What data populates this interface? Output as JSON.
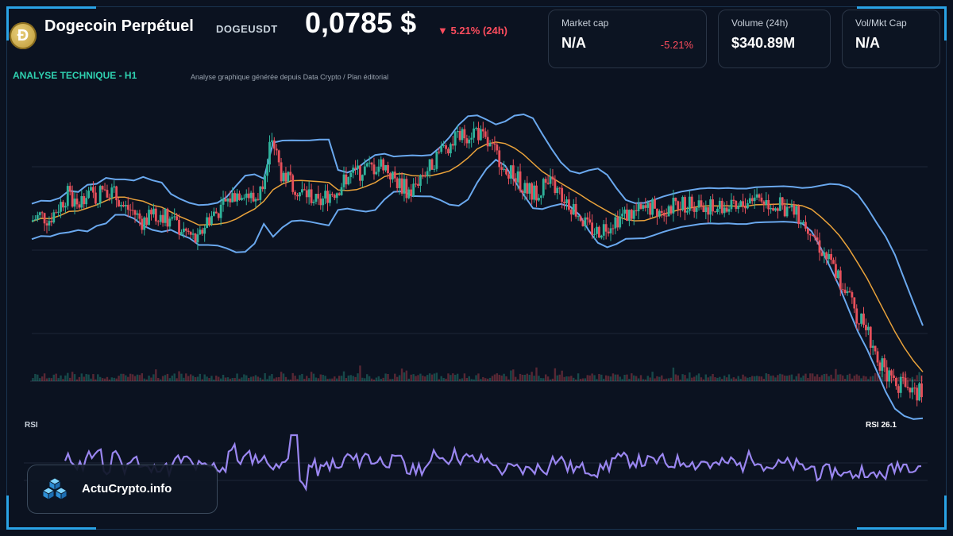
{
  "header": {
    "coin_icon": "dogecoin-icon",
    "coin_glyph": "Ð",
    "title": "Dogecoin Perpétuel",
    "ticker": "DOGEUSDT",
    "price": "0,0785 $",
    "change": "▼ 5.21% (24h)"
  },
  "cards": [
    {
      "label": "Market cap",
      "value": "N/A",
      "sub": "-5.21%"
    },
    {
      "label": "Volume (24h)",
      "value": "$340.89M",
      "sub": ""
    },
    {
      "label": "Vol/Mkt Cap",
      "value": "N/A",
      "sub": ""
    }
  ],
  "analysis": {
    "title": "ANALYSE TECHNIQUE - H1",
    "subtitle": "Analyse graphique générée depuis Data Crypto / Plan éditorial"
  },
  "rsi": {
    "label": "RSI",
    "value_label": "RSI 26.1"
  },
  "brand": {
    "name": "ActuCrypto.info",
    "icon": "cubes-icon"
  },
  "colors": {
    "up": "#2fb39b",
    "down": "#e8505b",
    "bollinger": "#6aa8ee",
    "ma": "#e9a23b",
    "rsi": "#9a86f0",
    "accent": "#2aa3e6",
    "ta_label": "#2fd1b0"
  },
  "chart_data": {
    "type": "line",
    "series": [
      {
        "values": [
          0.0912,
          0.0915,
          0.0913,
          0.0919,
          0.0925,
          0.0918,
          0.0927,
          0.0923,
          0.0929,
          0.0925,
          0.0919,
          0.0917,
          0.0912,
          0.0914,
          0.0916,
          0.0913,
          0.0909,
          0.0906,
          0.0902,
          0.0913,
          0.0916,
          0.0921,
          0.0925,
          0.0927,
          0.0922,
          0.0928,
          0.0952,
          0.0935,
          0.0932,
          0.0926,
          0.0925,
          0.092,
          0.0925,
          0.0927,
          0.0933,
          0.0935,
          0.0937,
          0.0938,
          0.094,
          0.0933,
          0.0929,
          0.0926,
          0.0934,
          0.0938,
          0.0945,
          0.0949,
          0.0952,
          0.0954,
          0.0956,
          0.095,
          0.0945,
          0.094,
          0.0934,
          0.093,
          0.0925,
          0.0928,
          0.093,
          0.0926,
          0.0921,
          0.0916,
          0.0909,
          0.0907,
          0.091,
          0.0913,
          0.0915,
          0.0916,
          0.0917,
          0.0919,
          0.0918,
          0.0919,
          0.0921,
          0.092,
          0.0921,
          0.0919,
          0.0918,
          0.0919,
          0.0917,
          0.0921,
          0.0925,
          0.0922,
          0.092,
          0.0919,
          0.0917,
          0.0913,
          0.0909,
          0.09,
          0.0893,
          0.0886,
          0.0876,
          0.0867,
          0.0861,
          0.0849,
          0.084,
          0.0834,
          0.0833,
          0.0831,
          0.083
        ]
      }
    ]
  }
}
